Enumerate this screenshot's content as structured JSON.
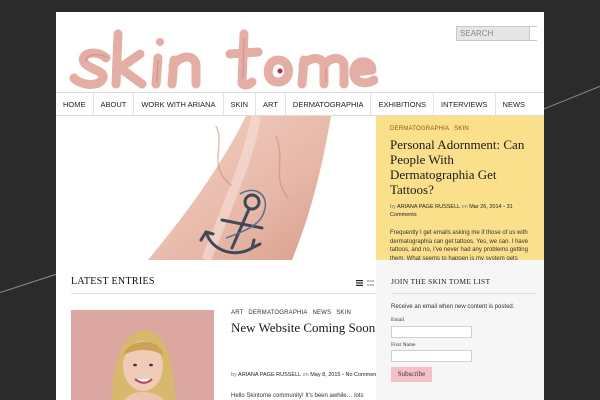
{
  "site": {
    "logo_text": "skin tome",
    "search_placeholder": "SEARCH"
  },
  "nav": [
    "HOME",
    "ABOUT",
    "WORK WITH ARIANA",
    "SKIN",
    "ART",
    "DERMATOGRAPHIA",
    "EXHIBITIONS",
    "INTERVIEWS",
    "NEWS"
  ],
  "featured": {
    "tags": [
      "DERMATOGRAPHIA",
      "SKIN"
    ],
    "title": "Personal Adornment: Can People With Dermatographia Get Tattoos?",
    "by": "by",
    "author": "ARIANA PAGE RUSSELL",
    "on": "on",
    "date": "Mar 26, 2014",
    "comments": "31 Comments",
    "excerpt": "Frequently I get emails asking me if those of us with dermatographia can get tattoos. Yes, we can. I have tattoos, and no, I've never had any problems getting them. What seems to happen is my system gets worn out from all of the allergies"
  },
  "latest": {
    "heading": "LATEST ENTRIES",
    "post": {
      "tags": [
        "ART",
        "DERMATOGRAPHIA",
        "NEWS",
        "SKIN"
      ],
      "title": "New Website Coming Soon!",
      "by": "by",
      "author": "ARIANA PAGE RUSSELL",
      "on": "on",
      "date": "May 8, 2015",
      "comments": "No Comments",
      "excerpt": "Hello Skintome community! It's been awhile… lots going on behind the scenes here at Skintome. First of"
    }
  },
  "sidebar": {
    "title": "JOIN THE SKIN TOME LIST",
    "text": "Receive an email when new content is posted.",
    "email_label": "Email",
    "first_name_label": "First Name",
    "subscribe_label": "Subscribe"
  },
  "colors": {
    "background": "#2b2b2b",
    "feature_bg": "#fbe08c",
    "subscribe_bg": "#f6c0c8",
    "logo_pink": "#e8b0a8"
  }
}
